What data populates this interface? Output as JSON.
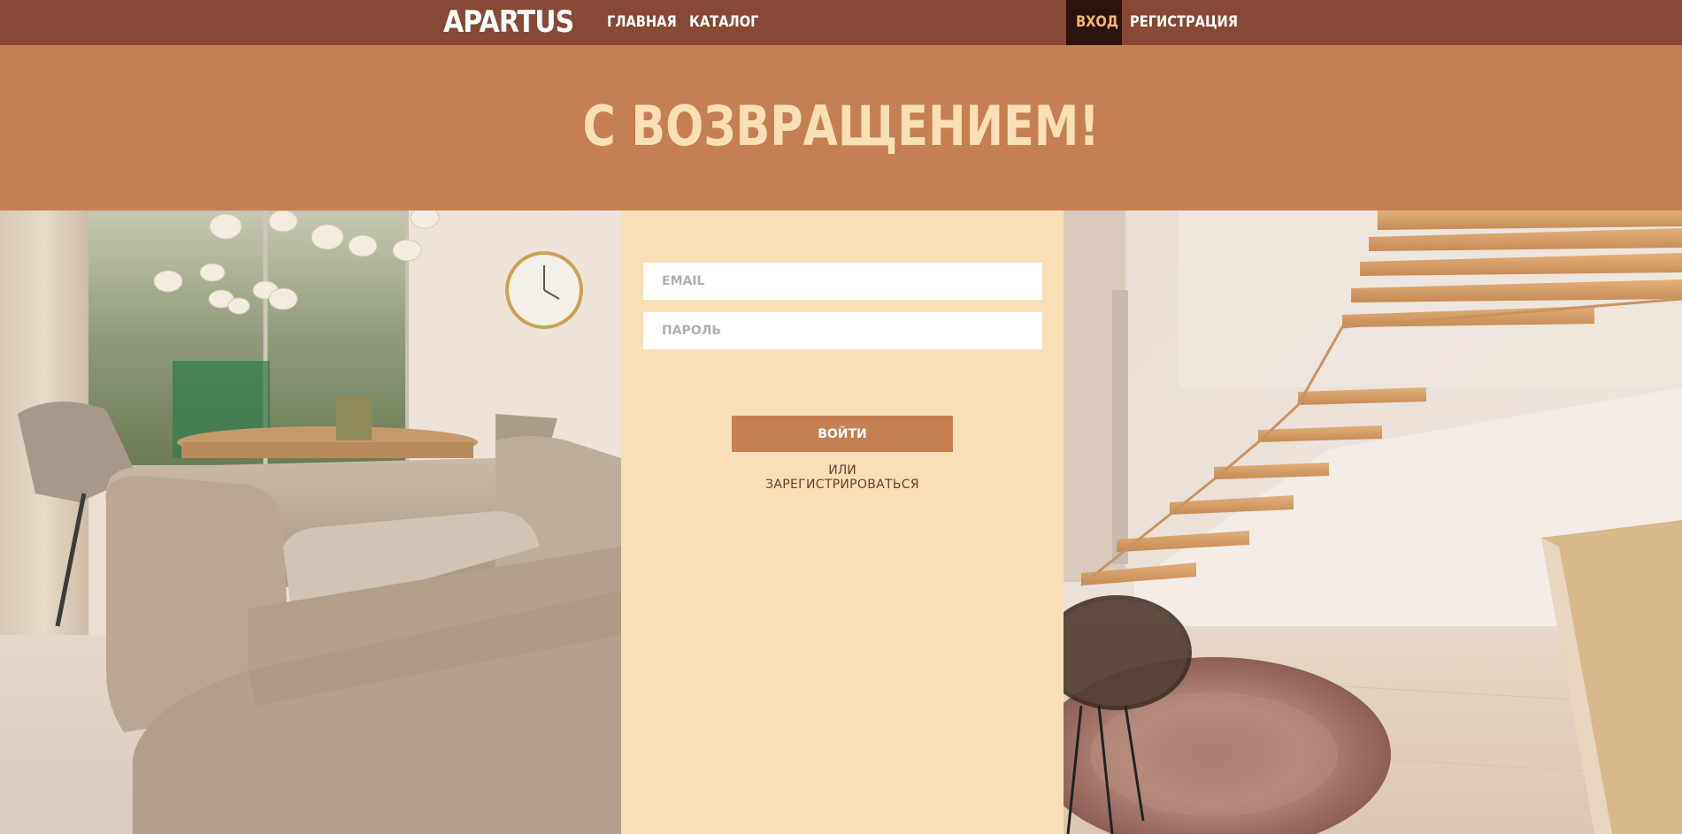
{
  "navbar": {
    "brand": "APARTUS",
    "links": {
      "home": "ГЛАВНАЯ",
      "catalog": "КАТАЛОГ",
      "login": "ВХОД",
      "register": "РЕГИСТРАЦИЯ"
    }
  },
  "hero": {
    "title": "С ВОЗВРАЩЕНИЕМ!"
  },
  "login_form": {
    "email_placeholder": "EMAIL",
    "password_placeholder": "ПАРОЛЬ",
    "submit_label": "ВОЙТИ",
    "or_text": "ИЛИ",
    "register_link": "ЗАРЕГИСТРИРОВАТЬСЯ"
  },
  "colors": {
    "navbar_bg": "#874936",
    "active_nav_bg": "#2b1410",
    "active_nav_text": "#f3b96c",
    "hero_bg": "#c57f52",
    "hero_text": "#f9dfb6",
    "form_bg": "#f9dfb8",
    "button_bg": "#c57f52",
    "link_text": "#6e3a28"
  },
  "images": {
    "left_panel": "living-room-photo",
    "right_panel": "staircase-interior-photo"
  }
}
